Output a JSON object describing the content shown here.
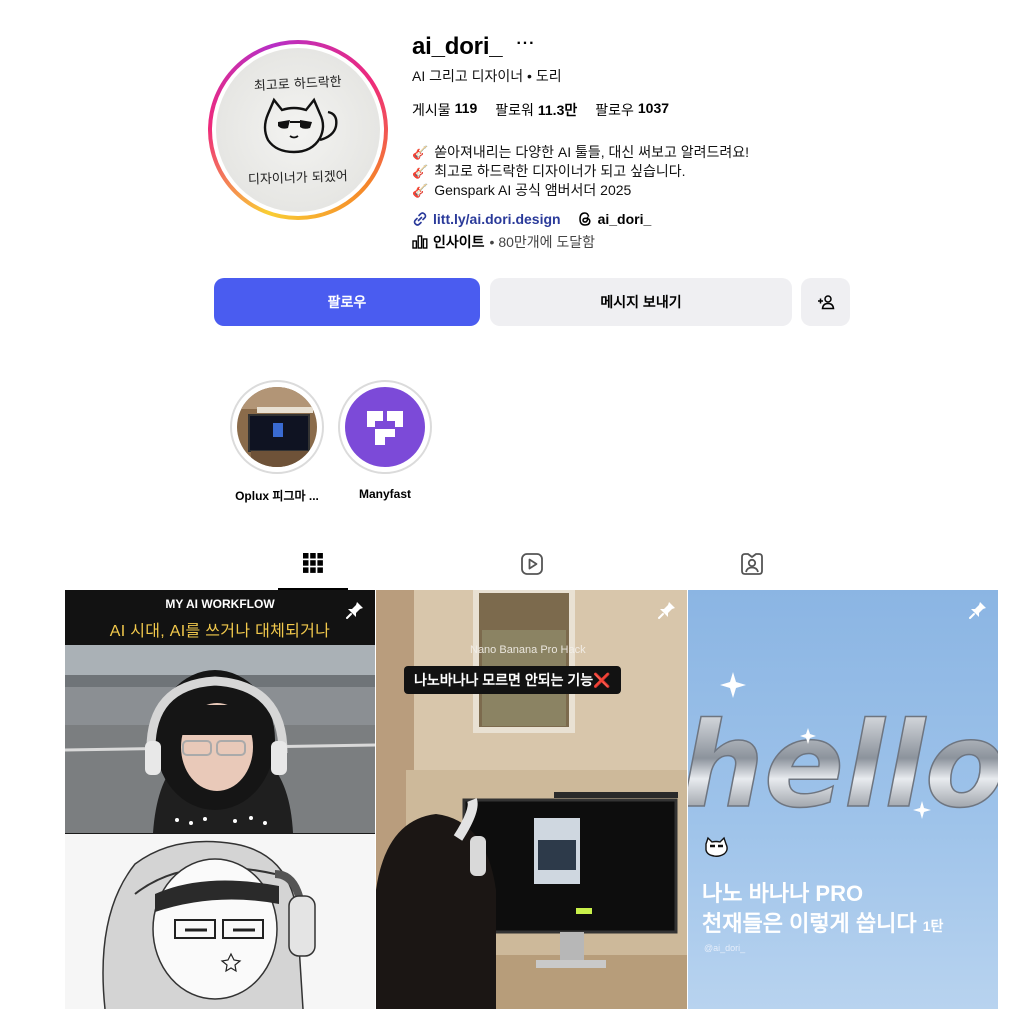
{
  "profile": {
    "username": "ai_dori_",
    "more": "···",
    "subtitle": "AI 그리고 디자이너 • 도리",
    "avatar_text_top": "최고로 하드락한",
    "avatar_text_bottom": "디자이너가 되겠어",
    "stats": [
      {
        "label": "게시물",
        "value": "119"
      },
      {
        "label": "팔로워",
        "value": "11.3만"
      },
      {
        "label": "팔로우",
        "value": "1037"
      }
    ],
    "bio": [
      {
        "icon": "🎸",
        "text": "쏟아져내리는 다양한 AI 툴들, 대신 써보고 알려드려요!"
      },
      {
        "icon": "🎸",
        "text": "최고로 하드락한 디자이너가 되고 싶습니다."
      },
      {
        "icon": "🎸",
        "text": "Genspark AI 공식 앰버서더 2025"
      }
    ],
    "link": "litt.ly/ai.dori.design",
    "threads_handle": "ai_dori_",
    "insight_label": "인사이트",
    "insight_detail": "• 80만개에 도달함"
  },
  "actions": {
    "follow": "팔로우",
    "message": "메시지 보내기"
  },
  "highlights": [
    {
      "label": "Oplux 피그마 ..."
    },
    {
      "label": "Manyfast"
    }
  ],
  "tabs": [
    "posts-grid-icon",
    "reels-icon",
    "tagged-icon"
  ],
  "posts": [
    {
      "banner_title": "MY AI WORKFLOW",
      "banner_sub": "AI 시대, AI를 쓰거나 대체되거나"
    },
    {
      "small_title": "Nano Banana Pro Hack",
      "tag": "나노바나나 모르면 안되는 기능❌"
    },
    {
      "art_word": "hello",
      "line1": "나노 바나나 PRO",
      "line2": "천재들은 이렇게 씁니다",
      "line2_suffix": "1탄",
      "handle": "@ai_dori_"
    }
  ],
  "colors": {
    "follow_button": "#4a5cf0",
    "secondary_button": "#efeff2",
    "link": "#2a3a9a"
  }
}
